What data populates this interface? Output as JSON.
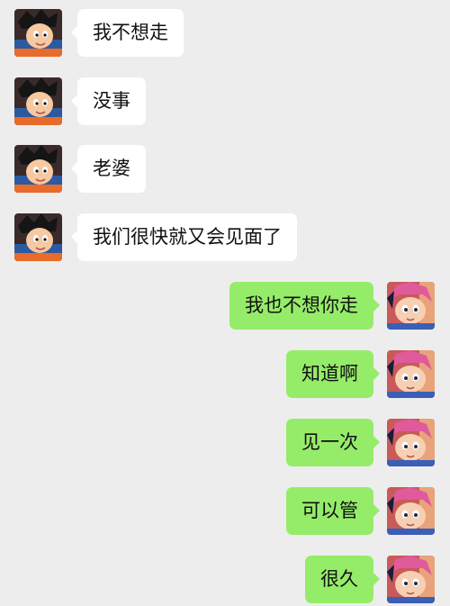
{
  "chat": {
    "messages": [
      {
        "side": "left",
        "text": "我不想走",
        "avatar_icon": "cartoon-boy-avatar-icon"
      },
      {
        "side": "left",
        "text": "没事",
        "avatar_icon": "cartoon-boy-avatar-icon"
      },
      {
        "side": "left",
        "text": "老婆",
        "avatar_icon": "cartoon-boy-avatar-icon"
      },
      {
        "side": "left",
        "text": "我们很快就又会见面了",
        "avatar_icon": "cartoon-boy-avatar-icon"
      },
      {
        "side": "right",
        "text": "我也不想你走",
        "avatar_icon": "cartoon-girl-avatar-icon"
      },
      {
        "side": "right",
        "text": "知道啊",
        "avatar_icon": "cartoon-girl-avatar-icon"
      },
      {
        "side": "right",
        "text": "见一次",
        "avatar_icon": "cartoon-girl-avatar-icon"
      },
      {
        "side": "right",
        "text": "可以管",
        "avatar_icon": "cartoon-girl-avatar-icon"
      },
      {
        "side": "right",
        "text": "很久",
        "avatar_icon": "cartoon-girl-avatar-icon"
      }
    ]
  },
  "colors": {
    "background": "#ededed",
    "incoming_bubble": "#ffffff",
    "outgoing_bubble": "#95ec69",
    "text": "#111111"
  }
}
